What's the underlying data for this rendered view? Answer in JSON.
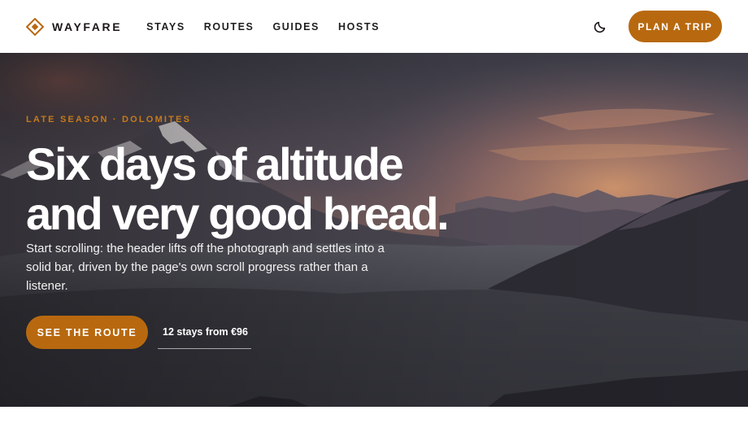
{
  "header": {
    "brand": "WAYFARE",
    "nav": [
      "STAYS",
      "ROUTES",
      "GUIDES",
      "HOSTS"
    ],
    "theme_icon": "moon-icon",
    "cta": "PLAN A TRIP"
  },
  "hero": {
    "eyebrow": "LATE SEASON · DOLOMITES",
    "headline_line1": "Six days of altitude",
    "headline_line2": "and very good bread.",
    "lede": "Start scrolling: the header lifts off the photograph and settles into a solid bar, driven by the page's own scroll progress rather than a listener.",
    "cta": "SEE THE ROUTE",
    "stays_link": "12 stays from €96"
  },
  "colors": {
    "accent": "#b8690f",
    "eyebrow": "#c67a1c",
    "text_dark": "#1c1917"
  }
}
